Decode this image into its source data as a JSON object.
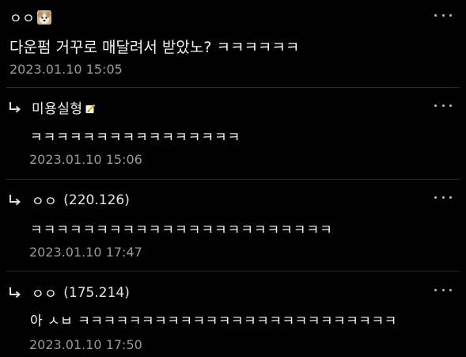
{
  "post": {
    "author": "ㅇㅇ",
    "body": "다운펌 거꾸로 매달려서 받았노? ㅋㅋㅋㅋㅋㅋ",
    "timestamp": "2023.01.10 15:05"
  },
  "replies": [
    {
      "author": "미용실형",
      "ip": "",
      "body": "ㅋㅋㅋㅋㅋㅋㅋㅋㅋㅋㅋㅋㅋㅋㅋㅋ",
      "timestamp": "2023.01.10 15:06"
    },
    {
      "author": "ㅇㅇ",
      "ip": "(220.126)",
      "body": "ㅋㅋㅋㅋㅋㅋㅋㅋㅋㅋㅋㅋㅋㅋㅋㅋㅋㅋㅋㅋㅋㅋㅋ",
      "timestamp": "2023.01.10 17:47"
    },
    {
      "author": "ㅇㅇ",
      "ip": "(175.214)",
      "body": "아 ㅅㅂ ㅋㅋㅋㅋㅋㅋㅋㅋㅋㅋㅋㅋㅋㅋㅋㅋㅋㅋㅋㅋㅋㅋㅋㅋㅋ",
      "timestamp": "2023.01.10 17:50"
    }
  ],
  "icons": {
    "more": "more-dots-icon",
    "reply": "reply-arrow-icon",
    "avatar": "dog-avatar-icon",
    "badge": "member-badge-icon"
  },
  "colors": {
    "background": "#000000",
    "text": "#f4f4f4",
    "timestamp": "#9a9a9a",
    "divider": "#2a2a2a"
  }
}
